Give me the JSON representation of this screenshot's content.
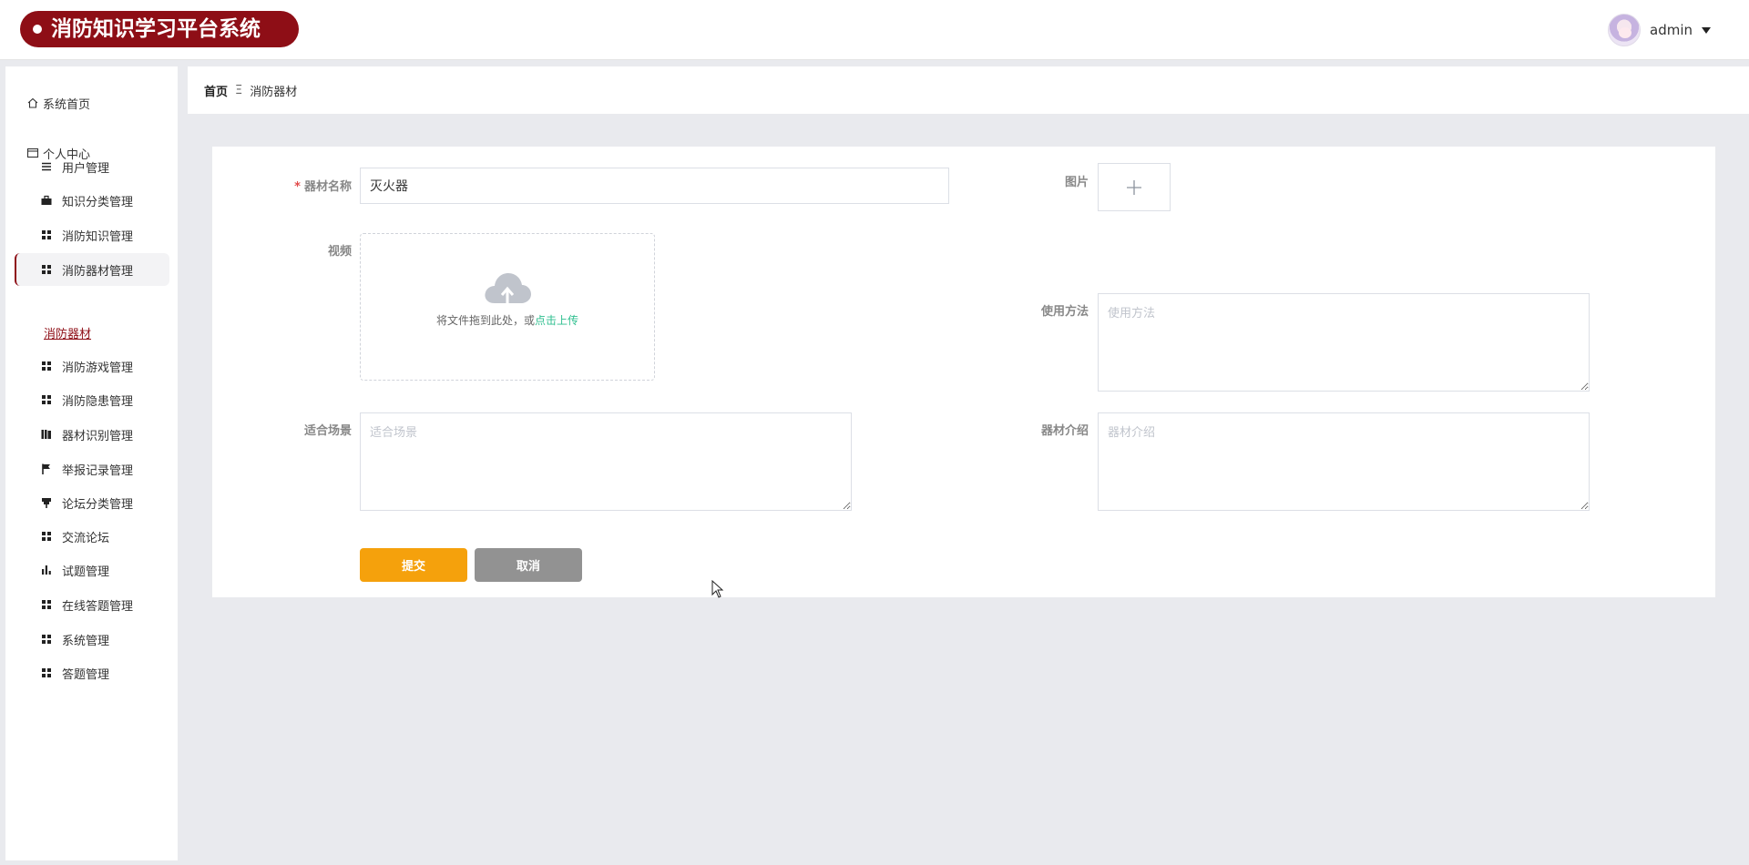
{
  "header": {
    "app_title": "消防知识学习平台系统",
    "username": "admin"
  },
  "sidebar": {
    "home_label": "系统首页",
    "center_label": "个人中心",
    "items": [
      {
        "label": "用户管理",
        "icon": "list-icon"
      },
      {
        "label": "知识分类管理",
        "icon": "briefcase-icon"
      },
      {
        "label": "消防知识管理",
        "icon": "grid-icon"
      },
      {
        "label": "消防器材管理",
        "icon": "grid-icon",
        "active": true
      },
      {
        "label": "消防游戏管理",
        "icon": "grid-icon"
      },
      {
        "label": "消防隐患管理",
        "icon": "grid-icon"
      },
      {
        "label": "器材识别管理",
        "icon": "books-icon"
      },
      {
        "label": "举报记录管理",
        "icon": "flag-icon"
      },
      {
        "label": "论坛分类管理",
        "icon": "pin-icon"
      },
      {
        "label": "交流论坛",
        "icon": "grid-icon"
      },
      {
        "label": "试题管理",
        "icon": "bar-chart-icon"
      },
      {
        "label": "在线答题管理",
        "icon": "grid-icon"
      },
      {
        "label": "系统管理",
        "icon": "grid-icon"
      },
      {
        "label": "答题管理",
        "icon": "grid-icon"
      }
    ],
    "submenu_label": "消防器材"
  },
  "breadcrumb": {
    "home": "首页",
    "separator": "Ξ",
    "current": "消防器材"
  },
  "form": {
    "name_label": "器材名称",
    "name_value": "灭火器",
    "image_label": "图片",
    "video_label": "视频",
    "upload_text": "将文件拖到此处，或",
    "upload_link": "点击上传",
    "usage_label": "使用方法",
    "usage_placeholder": "使用方法",
    "scene_label": "适合场景",
    "scene_placeholder": "适合场景",
    "intro_label": "器材介绍",
    "intro_placeholder": "器材介绍",
    "submit_label": "提交",
    "cancel_label": "取消"
  },
  "colors": {
    "brand": "#8e0e16",
    "submit": "#f5a10c",
    "cancel": "#929292",
    "upload_link": "#2fbf8f"
  }
}
